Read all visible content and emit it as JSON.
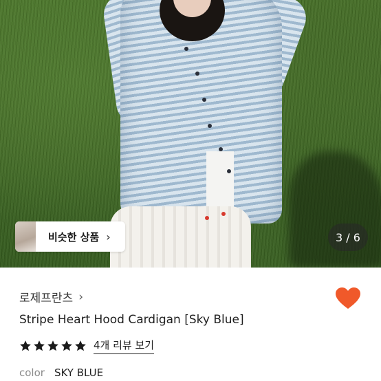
{
  "gallery": {
    "similar_label": "비슷한 상품",
    "page_indicator": "3 / 6"
  },
  "product": {
    "brand": "로제프란츠",
    "title": "Stripe Heart Hood Cardigan [Sky Blue]",
    "rating": 5,
    "rating_max": 5,
    "review_link": "4개 리뷰 보기",
    "option_label": "color",
    "option_value": "SKY BLUE"
  },
  "colors": {
    "accent": "#f0592a",
    "star": "#1a1a1a"
  },
  "icons": {
    "brand_chevron": "chevron-right-icon",
    "like": "heart-icon",
    "star": "star-icon"
  }
}
